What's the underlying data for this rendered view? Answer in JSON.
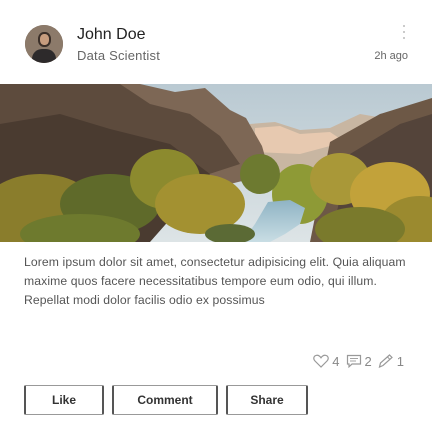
{
  "post": {
    "author": {
      "name": "John Doe",
      "title": "Data Scientist",
      "avatar": "avatar-photo"
    },
    "timestamp": "2h ago",
    "image": "canyon-landscape-photo",
    "text": "Lorem ipsum dolor sit amet, consectetur adipisicing elit. Quia aliquam maxime quos facere necessitatibus tempore eum odio, qui illum. Repellat modi dolor facilis odio ex possimus",
    "stats": {
      "likes": "4",
      "comments": "2",
      "shares": "1"
    },
    "actions": {
      "like_label": "Like",
      "comment_label": "Comment",
      "share_label": "Share"
    }
  },
  "icons": {
    "more": "more-vertical-icon",
    "heart": "heart-icon",
    "comment": "comment-icon",
    "share": "share-icon"
  }
}
